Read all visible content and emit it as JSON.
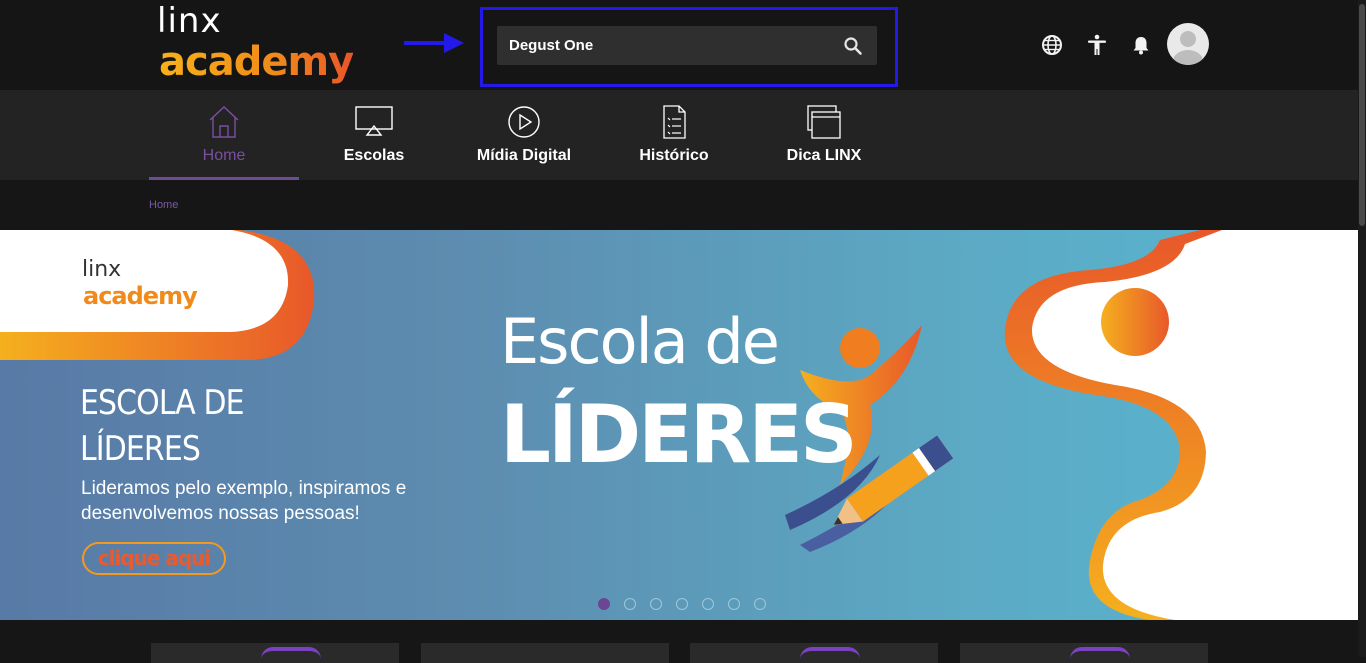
{
  "header": {
    "logo_line1": "linx",
    "logo_line2": "academy",
    "search": {
      "value": "Degust One",
      "placeholder": ""
    },
    "icons": [
      "globe-icon",
      "accessibility-icon",
      "bell-icon",
      "avatar"
    ]
  },
  "nav": {
    "items": [
      {
        "label": "Home",
        "icon": "home-icon",
        "active": true
      },
      {
        "label": "Escolas",
        "icon": "screen-icon"
      },
      {
        "label": "Mídia Digital",
        "icon": "play-icon"
      },
      {
        "label": "Histórico",
        "icon": "checklist-icon"
      },
      {
        "label": "Dica LINX",
        "icon": "windows-icon"
      }
    ]
  },
  "breadcrumb": {
    "current": "Home"
  },
  "banner": {
    "logo_line1": "linx",
    "logo_line2": "academy",
    "title_line1": "ESCOLA DE",
    "title_line2": "LÍDERES",
    "description": "Lideramos pelo exemplo, inspiramos e desenvolvemos nossas pessoas!",
    "cta": "clique aqui",
    "headline_line1": "Escola de",
    "headline_line2": "LÍDERES",
    "slides_total": 7,
    "active_slide": 1
  },
  "colors": {
    "accent": "#6d4b96",
    "highlight_box": "#2319e8",
    "brand_orange": "#f08a1a"
  }
}
